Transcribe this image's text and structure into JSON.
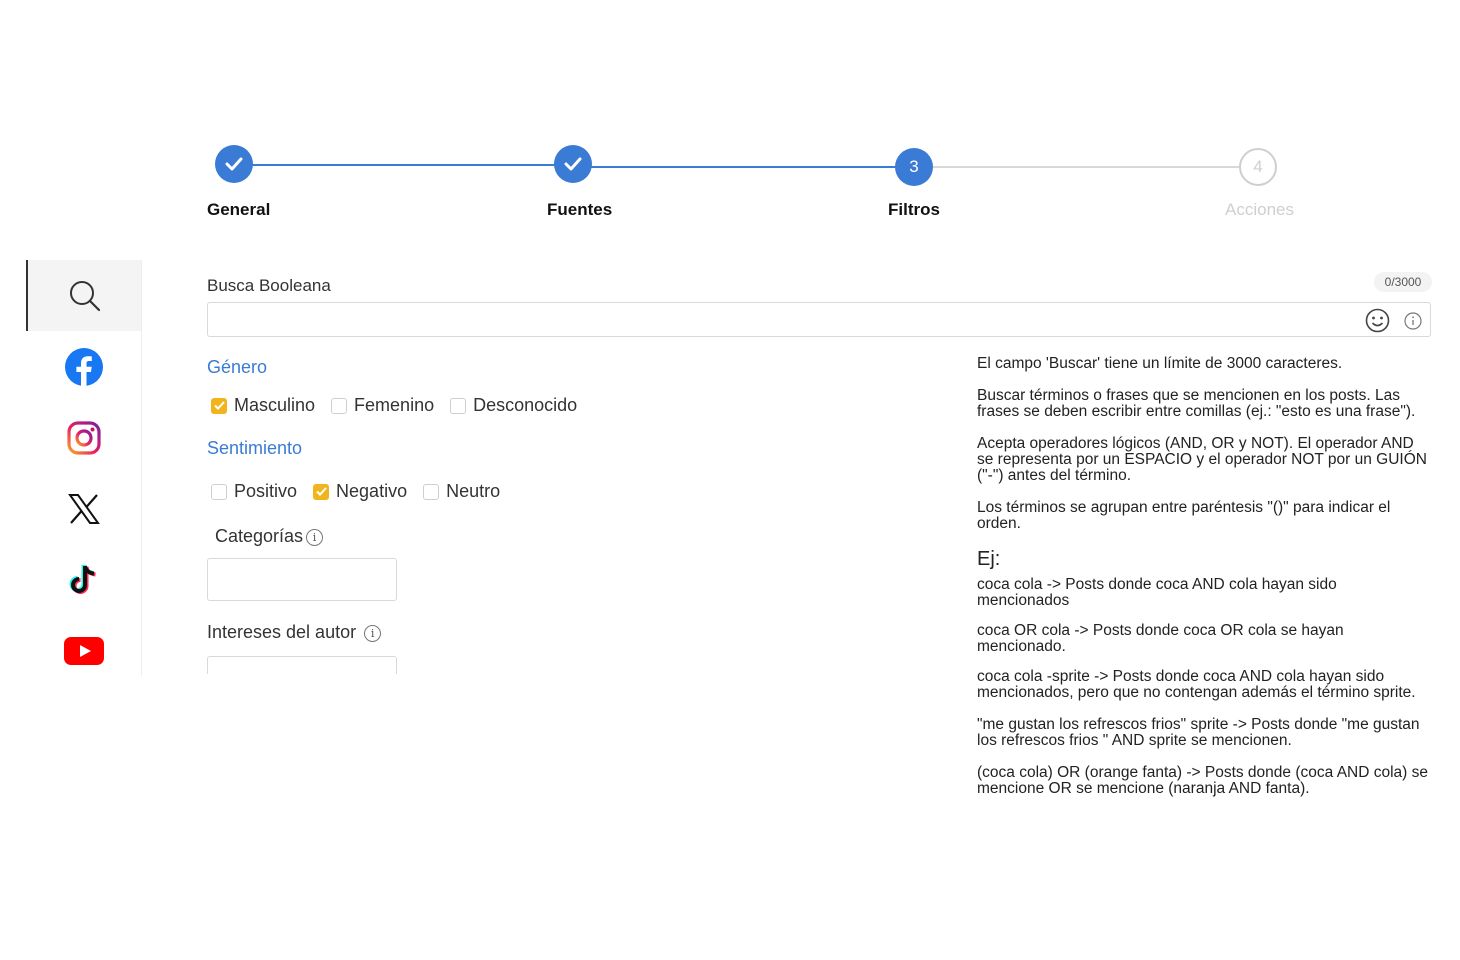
{
  "stepper": {
    "steps": [
      {
        "label": "General",
        "state": "done",
        "number": ""
      },
      {
        "label": "Fuentes",
        "state": "done",
        "number": ""
      },
      {
        "label": "Filtros",
        "state": "active",
        "number": "3"
      },
      {
        "label": "Acciones",
        "state": "todo",
        "number": "4"
      }
    ],
    "accent_color": "#3a7bd5"
  },
  "sidebar": {
    "items": [
      {
        "icon": "search-icon",
        "active": true
      },
      {
        "icon": "facebook-icon",
        "active": false
      },
      {
        "icon": "instagram-icon",
        "active": false
      },
      {
        "icon": "x-icon",
        "active": false
      },
      {
        "icon": "tiktok-icon",
        "active": false
      },
      {
        "icon": "youtube-icon",
        "active": false
      }
    ]
  },
  "search": {
    "label": "Busca Booleana",
    "counter": "0/3000",
    "value": "",
    "placeholder": ""
  },
  "gender": {
    "title": "Género",
    "options": [
      {
        "label": "Masculino",
        "checked": true
      },
      {
        "label": "Femenino",
        "checked": false
      },
      {
        "label": "Desconocido",
        "checked": false
      }
    ]
  },
  "sentiment": {
    "title": "Sentimiento",
    "options": [
      {
        "label": "Positivo",
        "checked": false
      },
      {
        "label": "Negativo",
        "checked": true
      },
      {
        "label": "Neutro",
        "checked": false
      }
    ]
  },
  "categories": {
    "label": "Categorías"
  },
  "author_interests": {
    "label": "Intereses del autor"
  },
  "tooltip": {
    "p1": "El campo 'Buscar' tiene un límite de 3000 caracteres.",
    "p2": "Buscar términos o frases que se mencionen en los posts. Las frases se deben escribir entre comillas (ej.: \"esto es una frase\").",
    "p3": "Acepta operadores lógicos (AND, OR y NOT). El operador AND se representa por un ESPACIO y el operador NOT por un GUIÓN (\"-\") antes del término.",
    "p4": "Los términos se agrupan entre paréntesis \"()\" para indicar el orden.",
    "example_title": "Ej:",
    "ex1": "coca cola -> Posts donde coca AND cola hayan sido mencionados",
    "ex2": "coca OR cola -> Posts donde coca OR cola se hayan mencionado.",
    "ex3": "coca cola -sprite -> Posts donde coca AND cola hayan sido mencionados, pero que no contengan además el término sprite.",
    "ex4": "\"me gustan los refrescos frios\" sprite -> Posts donde \"me gustan los refrescos frios \" AND sprite se mencionen.",
    "ex5": "(coca cola) OR (orange fanta) -> Posts donde (coca AND cola) se mencione OR se mencione (naranja AND fanta)."
  },
  "colors": {
    "checkbox_on": "#f2b41c",
    "section_title": "#3a7bd5"
  }
}
